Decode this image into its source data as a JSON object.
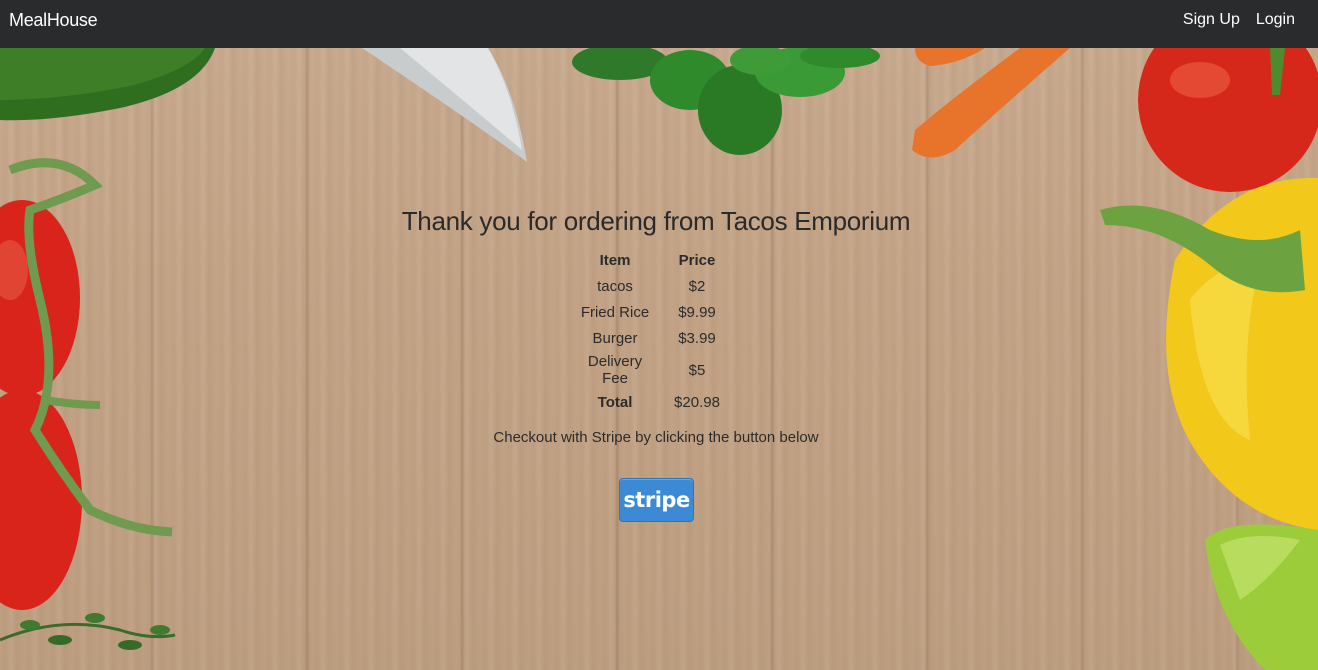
{
  "navbar": {
    "brand": "MealHouse",
    "links": [
      "Sign Up",
      "Login"
    ]
  },
  "order": {
    "title": "Thank you for ordering from Tacos Emporium",
    "columns": [
      "Item",
      "Price"
    ],
    "items": [
      {
        "name": "tacos",
        "price": "$2"
      },
      {
        "name": "Fried Rice",
        "price": "$9.99"
      },
      {
        "name": "Burger",
        "price": "$3.99"
      },
      {
        "name": "Delivery Fee",
        "price": "$5"
      }
    ],
    "total_label": "Total",
    "total_value": "$20.98"
  },
  "checkout": {
    "text": "Checkout with Stripe by clicking the button below",
    "button_label": "stripe"
  },
  "colors": {
    "navbar_bg": "#292b2c",
    "stripe_blue": "#3c8ad6",
    "wood": "#c4a487"
  }
}
